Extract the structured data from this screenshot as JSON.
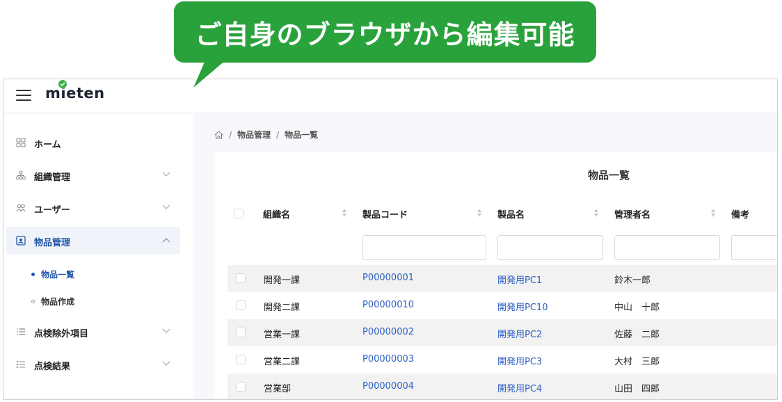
{
  "callout": {
    "text": "ご自身のブラウザから編集可能"
  },
  "app": {
    "logo": {
      "pre": "m",
      "i": "i",
      "post": "eten"
    },
    "sidebar": {
      "items": [
        {
          "label": "ホーム",
          "icon": "grid-icon"
        },
        {
          "label": "組織管理",
          "icon": "org-tree-icon"
        },
        {
          "label": "ユーザー",
          "icon": "users-icon"
        },
        {
          "label": "物品管理",
          "icon": "asset-icon"
        },
        {
          "label": "点検除外項目",
          "icon": "list-icon"
        },
        {
          "label": "点検結果",
          "icon": "checklist-icon"
        }
      ],
      "subitems": [
        {
          "label": "物品一覧"
        },
        {
          "label": "物品作成"
        }
      ]
    },
    "breadcrumb": {
      "home_icon": "home-icon",
      "items": [
        "物品管理",
        "物品一覧"
      ],
      "separator": "/"
    },
    "card": {
      "title": "物品一覧",
      "columns": [
        "組織名",
        "製品コード",
        "製品名",
        "管理者名",
        "備考"
      ],
      "rows": [
        {
          "org": "開発一課",
          "code": "P00000001",
          "name": "開発用PC1",
          "manager": "鈴木一郎"
        },
        {
          "org": "開発二課",
          "code": "P00000010",
          "name": "開発用PC10",
          "manager": "中山　十郎"
        },
        {
          "org": "営業一課",
          "code": "P00000002",
          "name": "開発用PC2",
          "manager": "佐藤　二郎"
        },
        {
          "org": "営業二課",
          "code": "P00000003",
          "name": "開発用PC3",
          "manager": "大村　三郎"
        },
        {
          "org": "営業部",
          "code": "P00000004",
          "name": "開発用PC4",
          "manager": "山田　四郎"
        }
      ]
    }
  },
  "colors": {
    "callout": "#2aa23c",
    "accent": "#1f57a8",
    "link": "#2c5fc4"
  }
}
